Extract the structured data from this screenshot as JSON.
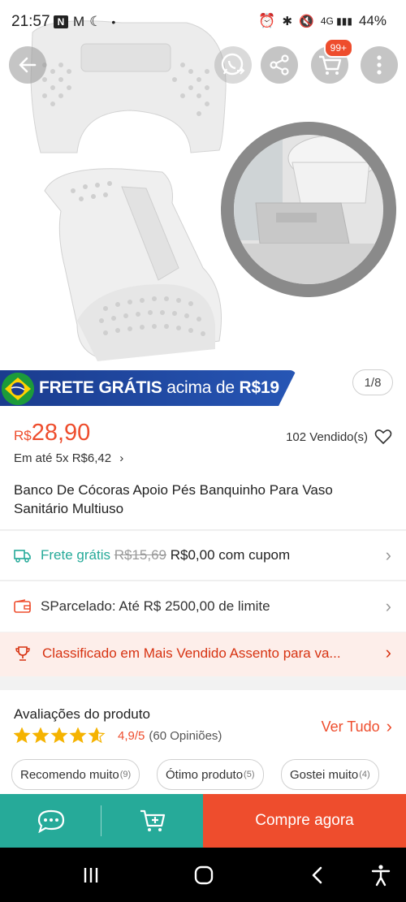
{
  "status_bar": {
    "time": "21:57",
    "battery": "44%"
  },
  "product_image": {
    "pager": "1/8"
  },
  "header": {
    "cart_badge": "99+"
  },
  "banner": {
    "text_bold1": "FRETE GRÁTIS",
    "text_mid": " acima de ",
    "text_bold2": "R$19"
  },
  "price": {
    "currency": "R$",
    "value": "28,90",
    "installments": "Em até 5x R$6,42",
    "sold": "102 Vendido(s)"
  },
  "product": {
    "title": "Banco De Cócoras Apoio Pés Banquinho Para Vaso Sanitário Multiuso"
  },
  "shipping": {
    "label": "Frete grátis",
    "old_price": "R$15,69",
    "new_price": "R$0,00 com cupom"
  },
  "credit": {
    "label": "SParcelado: Até R$ 2500,00 de limite"
  },
  "ranking": {
    "label": "Classificado em Mais Vendido Assento para va..."
  },
  "reviews": {
    "heading": "Avaliações do produto",
    "score": "4,9/5",
    "count": "(60 Opiniões)",
    "see_all": "Ver Tudo",
    "rating": 4.9,
    "chips": [
      {
        "label": "Recomendo muito",
        "count": "(9)"
      },
      {
        "label": "Ótimo produto",
        "count": "(5)"
      },
      {
        "label": "Gostei muito",
        "count": "(4)"
      }
    ]
  },
  "actions": {
    "buy": "Compre agora"
  },
  "colors": {
    "accent": "#ee4d2d",
    "teal": "#26aa99",
    "banner_blue": "#1a3c8e"
  }
}
